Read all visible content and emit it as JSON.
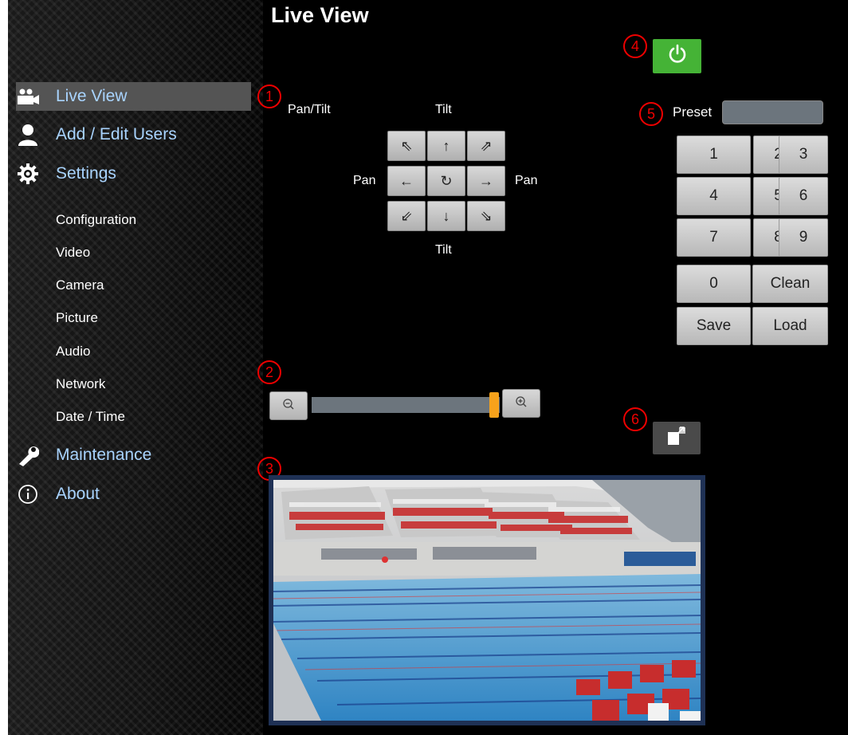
{
  "page": {
    "title": "Live View"
  },
  "sidebar": {
    "items": [
      {
        "label": "Live View",
        "icon": "video-camera-icon"
      },
      {
        "label": "Add / Edit Users",
        "icon": "user-icon"
      },
      {
        "label": "Settings",
        "icon": "gear-icon"
      },
      {
        "label": "Maintenance",
        "icon": "wrench-icon"
      },
      {
        "label": "About",
        "icon": "info-icon"
      }
    ],
    "settings_sub": [
      "Configuration",
      "Video",
      "Camera",
      "Picture",
      "Audio",
      "Network",
      "Date / Time"
    ]
  },
  "ptz": {
    "pan_tilt_label": "Pan/Tilt",
    "tilt_top": "Tilt",
    "tilt_bottom": "Tilt",
    "pan_left": "Pan",
    "pan_right": "Pan",
    "glyphs": {
      "ul": "⇖",
      "up": "↑",
      "ur": "⇗",
      "left": "←",
      "home": "↻",
      "right": "→",
      "dl": "⇙",
      "down": "↓",
      "dr": "⇘"
    }
  },
  "preset": {
    "label": "Preset",
    "value": "",
    "keys": [
      "1",
      "2",
      "3",
      "4",
      "5",
      "6",
      "7",
      "8",
      "9",
      "0",
      "Clean",
      "Save",
      "Load"
    ]
  },
  "zoom": {
    "level": 0.97
  },
  "annotations": [
    "1",
    "2",
    "3",
    "4",
    "5",
    "6"
  ],
  "colors": {
    "nav_text": "#a9d4ff",
    "power_button": "#45b336",
    "zoom_handle": "#f7a21b",
    "annotation": "#e00000"
  }
}
